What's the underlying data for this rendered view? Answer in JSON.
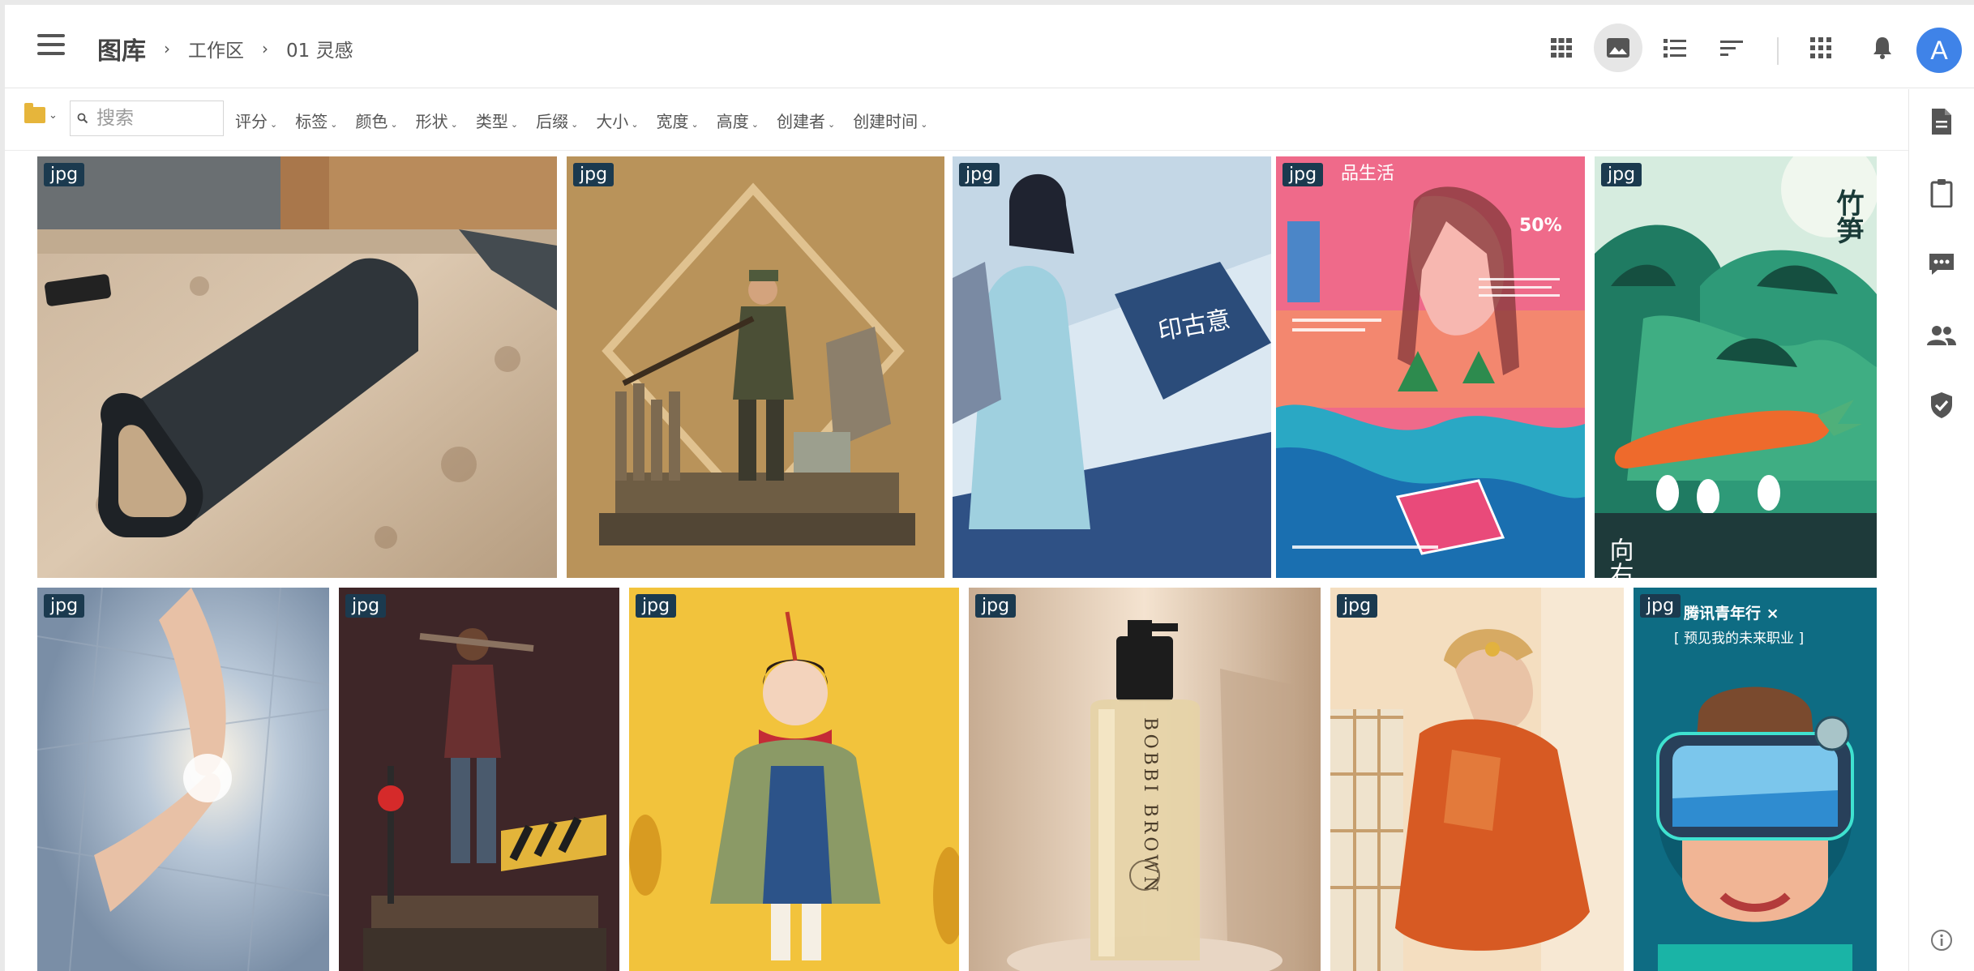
{
  "header": {
    "breadcrumb_root": "图库",
    "breadcrumb_items": [
      "工作区",
      "01 灵感"
    ],
    "avatar_initial": "A"
  },
  "filterbar": {
    "search_placeholder": "搜索",
    "filters": [
      "评分",
      "标签",
      "颜色",
      "形状",
      "类型",
      "后缀",
      "大小",
      "宽度",
      "高度",
      "创建者",
      "创建时间"
    ]
  },
  "icons": {
    "header": [
      "grid-icon",
      "image-view-icon",
      "list-icon",
      "sort-icon",
      "apps-icon",
      "bell-icon"
    ],
    "sidebar": [
      "document-icon",
      "clipboard-icon",
      "comment-icon",
      "people-icon",
      "shield-check-icon",
      "info-icon"
    ]
  },
  "colors": {
    "accent": "#3f83e8",
    "badge": "#1b3a4f",
    "folder": "#e6b53b"
  },
  "gallery": {
    "items": [
      {
        "badge": "jpg"
      },
      {
        "badge": "jpg"
      },
      {
        "badge": "jpg",
        "text": "印古意"
      },
      {
        "badge": "jpg",
        "text": "品生活",
        "text2": "50%"
      },
      {
        "badge": "jpg",
        "text": "竹笋",
        "text2": "向右"
      },
      {
        "badge": "jpg"
      },
      {
        "badge": "jpg"
      },
      {
        "badge": "jpg"
      },
      {
        "badge": "jpg",
        "text": "BOBBI BROWN"
      },
      {
        "badge": "jpg"
      },
      {
        "badge": "jpg",
        "text": "腾讯青年行 ×",
        "text2": "[ 预见我的未来职业 ]"
      }
    ]
  }
}
